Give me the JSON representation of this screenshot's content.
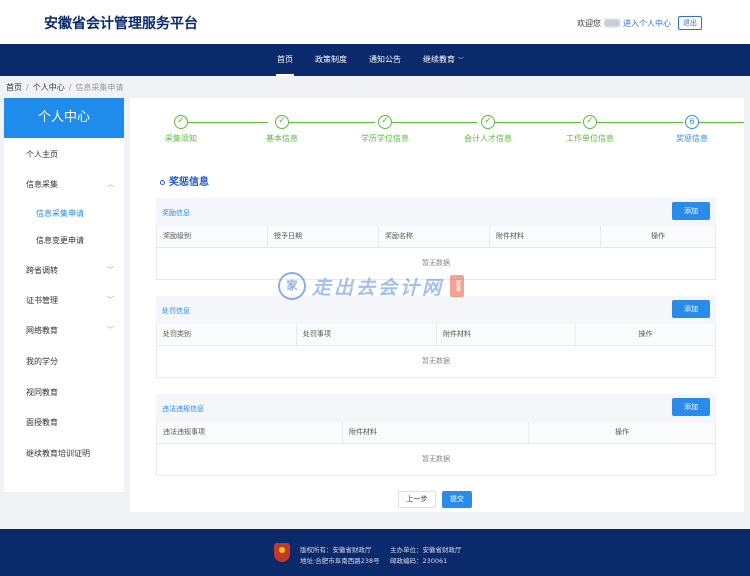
{
  "header": {
    "site_title": "安徽省会计管理服务平台",
    "welcome": "欢迎您",
    "enter_center": "进入个人中心",
    "logout": "退出"
  },
  "nav": {
    "items": [
      {
        "label": "首页",
        "active": true
      },
      {
        "label": "政策制度"
      },
      {
        "label": "通知公告"
      },
      {
        "label": "继续教育",
        "dropdown": true
      }
    ],
    "caret": "﹀"
  },
  "breadcrumb": {
    "home": "首页",
    "center": "个人中心",
    "current": "信息采集申请",
    "sep": "/"
  },
  "sidebar": {
    "title": "个人中心",
    "items": [
      {
        "label": "个人主页"
      },
      {
        "label": "信息采集",
        "chevron": "︿"
      },
      {
        "label": "信息采集申请",
        "sub": true,
        "active": true
      },
      {
        "label": "信息变更申请",
        "sub": true
      },
      {
        "label": "跨省调转",
        "chevron": "﹀"
      },
      {
        "label": "证书管理",
        "chevron": "﹀"
      },
      {
        "label": "网络教育",
        "chevron": "﹀"
      },
      {
        "label": "我的学分"
      },
      {
        "label": "视同教育"
      },
      {
        "label": "面授教育"
      },
      {
        "label": "继续教育培训证明"
      }
    ]
  },
  "steps": [
    {
      "label": "采集须知",
      "mark": "✓"
    },
    {
      "label": "基本信息",
      "mark": "✓"
    },
    {
      "label": "学历学位信息",
      "mark": "✓"
    },
    {
      "label": "会计人才信息",
      "mark": "✓"
    },
    {
      "label": "工作单位信息",
      "mark": "✓"
    },
    {
      "label": "奖惩信息",
      "mark": "6",
      "current": true
    }
  ],
  "section_title": "奖惩信息",
  "blocks": [
    {
      "title": "奖励信息",
      "add": "添加",
      "columns": [
        "奖励级别",
        "授予日期",
        "奖励名称",
        "附件材料",
        "操作"
      ],
      "empty": "暂无数据"
    },
    {
      "title": "处罚信息",
      "add": "添加",
      "columns": [
        "处罚类别",
        "处罚事项",
        "附件材料",
        "操作"
      ],
      "empty": "暂无数据"
    },
    {
      "title": "违法违规信息",
      "add": "添加",
      "columns": [
        "违法违规事项",
        "附件材料",
        "操作"
      ],
      "empty": "暂无数据"
    }
  ],
  "buttons": {
    "prev": "上一步",
    "submit": "提交"
  },
  "watermark": {
    "seal": "家",
    "text": "走出去会计网",
    "stamp": "家奉"
  },
  "footer": {
    "copyright": "版权所有：安徽省财政厅",
    "host": "主办单位：安徽省财政厅",
    "address": "地址:合肥市阜南西路238号",
    "postcode": "邮政编码：230061"
  },
  "colors": {
    "navy": "#0b2a6b",
    "primary": "#1f8ceb",
    "step_done": "#5bbd3a"
  }
}
